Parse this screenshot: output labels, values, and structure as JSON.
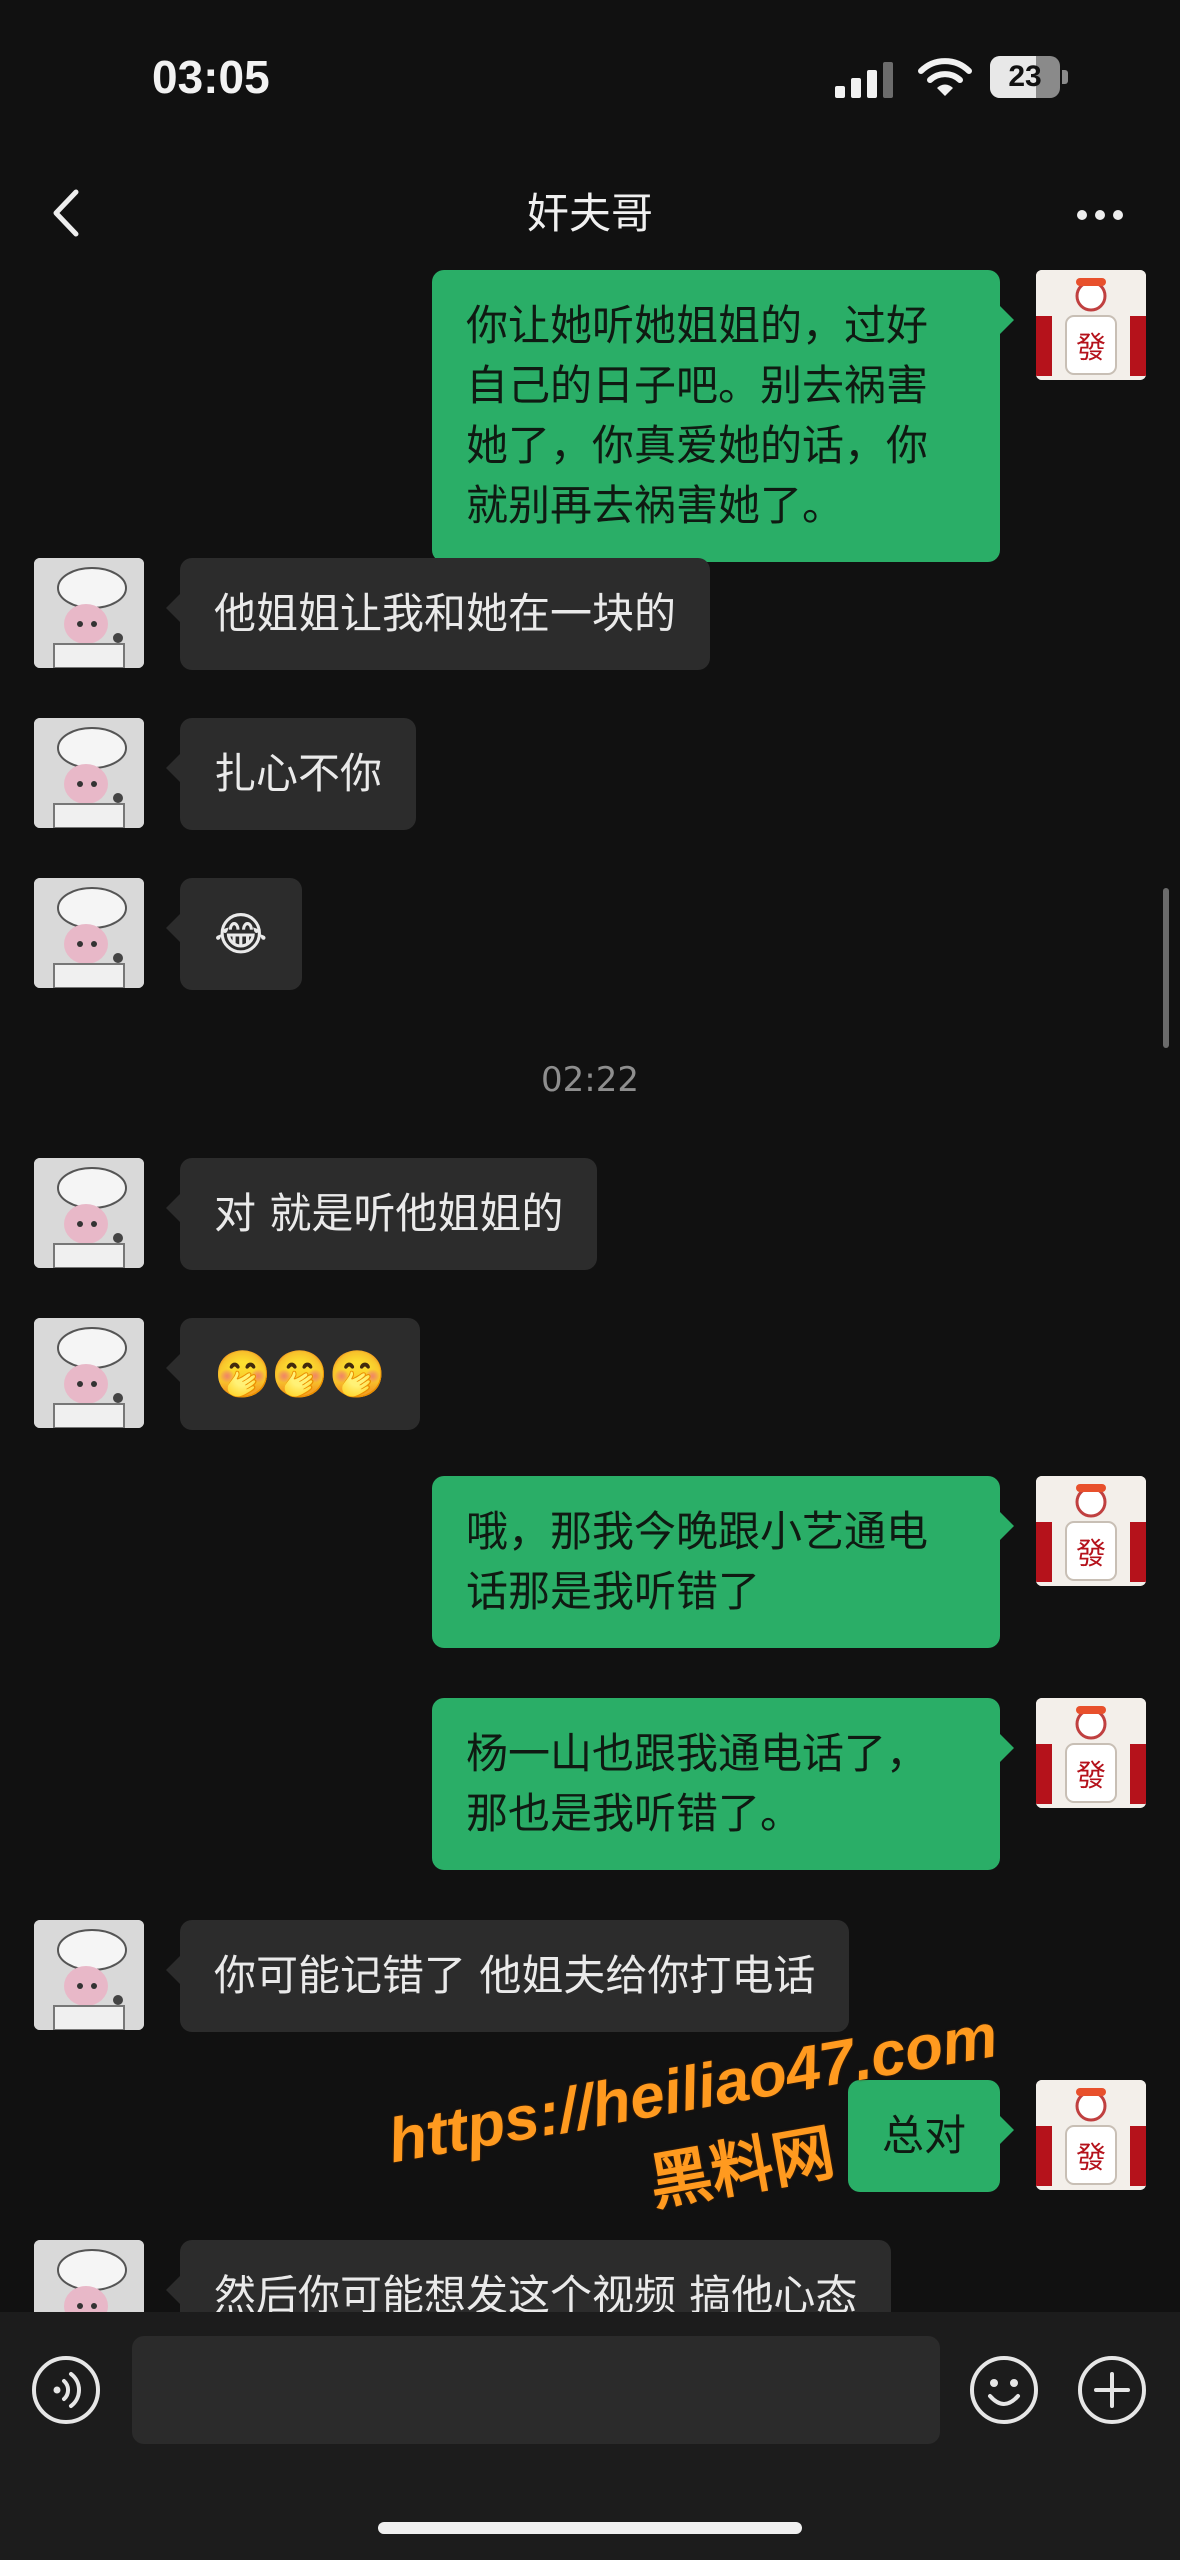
{
  "status": {
    "time": "03:05",
    "battery": "23"
  },
  "header": {
    "title": "奸夫哥"
  },
  "timestamp": "02:22",
  "messages": [
    {
      "side": "out",
      "text": "你让她听她姐姐的，过好自己的日子吧。别去祸害她了，你真爱她的话，你就别再去祸害她了。"
    },
    {
      "side": "in",
      "text": "他姐姐让我和她在一块的"
    },
    {
      "side": "in",
      "text": "扎心不你"
    },
    {
      "side": "in",
      "text": "😂"
    },
    {
      "side": "in",
      "text": "对 就是听他姐姐的"
    },
    {
      "side": "in",
      "text": "🤭🤭🤭"
    },
    {
      "side": "out",
      "text": "哦，那我今晚跟小艺通电话那是我听错了"
    },
    {
      "side": "out",
      "text": "杨一山也跟我通电话了，那也是我听错了。"
    },
    {
      "side": "in",
      "text": "你可能记错了 他姐夫给你打电话"
    },
    {
      "side": "out",
      "text": "总对"
    },
    {
      "side": "in",
      "text": "然后你可能想发这个视频 搞他心态"
    }
  ],
  "watermark": {
    "url": "https://heiliao47.com",
    "site": "黑料网"
  },
  "input": {
    "placeholder": ""
  }
}
